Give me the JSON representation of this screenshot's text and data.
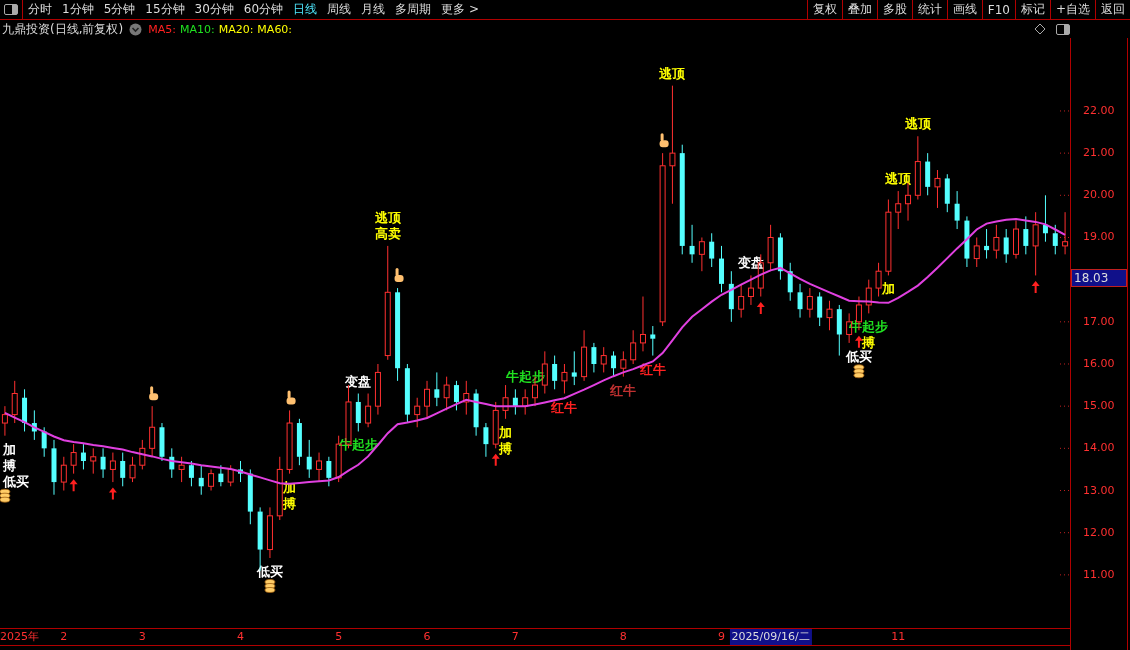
{
  "toolbar": {
    "periods": [
      {
        "label": "分时",
        "selected": false
      },
      {
        "label": "1分钟",
        "selected": false
      },
      {
        "label": "5分钟",
        "selected": false
      },
      {
        "label": "15分钟",
        "selected": false
      },
      {
        "label": "30分钟",
        "selected": false
      },
      {
        "label": "60分钟",
        "selected": false
      },
      {
        "label": "日线",
        "selected": true
      },
      {
        "label": "周线",
        "selected": false
      },
      {
        "label": "月线",
        "selected": false
      },
      {
        "label": "多周期",
        "selected": false
      },
      {
        "label": "更多 >",
        "selected": false
      }
    ],
    "buttons": [
      "复权",
      "叠加",
      "多股",
      "统计",
      "画线",
      "F10",
      "标记",
      "+自选",
      "返回"
    ]
  },
  "info": {
    "title": "九鼎投资(日线,前复权)",
    "indicators": [
      {
        "label": "MA5:",
        "color": "#ff2020"
      },
      {
        "label": "MA10:",
        "color": "#20e020"
      },
      {
        "label": "MA20:",
        "color": "#ffff00"
      },
      {
        "label": "MA60:",
        "color": "#ffff00"
      }
    ]
  },
  "chart_data": {
    "type": "candlestick",
    "categories": [
      null,
      "2025年",
      null,
      null,
      null,
      null,
      "2",
      null,
      null,
      null,
      null,
      null,
      null,
      null,
      "3",
      null,
      null,
      null,
      null,
      null,
      null,
      null,
      null,
      null,
      "4",
      null,
      null,
      null,
      null,
      null,
      null,
      null,
      null,
      null,
      "5",
      null,
      null,
      null,
      null,
      null,
      null,
      null,
      null,
      "6",
      null,
      null,
      null,
      null,
      null,
      null,
      null,
      null,
      "7",
      null,
      null,
      null,
      null,
      null,
      null,
      null,
      null,
      null,
      null,
      "8",
      null,
      null,
      null,
      null,
      null,
      null,
      null,
      null,
      null,
      "9",
      null,
      null,
      null,
      null,
      null,
      null,
      null,
      null,
      null,
      null,
      null,
      null,
      null,
      null,
      null,
      null,
      null,
      "11",
      null,
      null,
      null,
      null,
      null,
      null,
      null,
      null,
      null,
      null,
      null,
      null,
      null,
      null,
      null,
      null,
      null
    ],
    "ohlc": [
      [
        14.6,
        15.0,
        14.3,
        14.8
      ],
      [
        14.8,
        15.6,
        14.6,
        15.3
      ],
      [
        15.2,
        15.4,
        14.4,
        14.6
      ],
      [
        14.6,
        14.9,
        14.2,
        14.4
      ],
      [
        14.4,
        14.5,
        13.8,
        14.0
      ],
      [
        14.0,
        14.2,
        12.9,
        13.2
      ],
      [
        13.2,
        13.8,
        13.0,
        13.6
      ],
      [
        13.6,
        14.1,
        13.4,
        13.9
      ],
      [
        13.9,
        14.1,
        13.5,
        13.7
      ],
      [
        13.7,
        14.0,
        13.4,
        13.8
      ],
      [
        13.8,
        14.0,
        13.3,
        13.5
      ],
      [
        13.5,
        13.9,
        13.2,
        13.7
      ],
      [
        13.7,
        13.9,
        13.1,
        13.3
      ],
      [
        13.3,
        13.8,
        13.2,
        13.6
      ],
      [
        13.6,
        14.2,
        13.5,
        14.0
      ],
      [
        14.0,
        15.0,
        13.8,
        14.5
      ],
      [
        14.5,
        14.6,
        13.7,
        13.8
      ],
      [
        13.8,
        14.0,
        13.3,
        13.5
      ],
      [
        13.5,
        13.8,
        13.2,
        13.6
      ],
      [
        13.6,
        13.7,
        13.1,
        13.3
      ],
      [
        13.3,
        13.6,
        12.9,
        13.1
      ],
      [
        13.1,
        13.5,
        13.0,
        13.4
      ],
      [
        13.4,
        13.6,
        13.1,
        13.2
      ],
      [
        13.2,
        13.6,
        13.1,
        13.5
      ],
      [
        13.5,
        13.7,
        13.2,
        13.4
      ],
      [
        13.4,
        13.5,
        12.2,
        12.5
      ],
      [
        12.5,
        12.6,
        11.1,
        11.6
      ],
      [
        11.6,
        12.6,
        11.4,
        12.4
      ],
      [
        12.4,
        13.8,
        12.3,
        13.5
      ],
      [
        13.5,
        14.9,
        13.4,
        14.6
      ],
      [
        14.6,
        14.7,
        13.6,
        13.8
      ],
      [
        13.8,
        14.2,
        13.3,
        13.5
      ],
      [
        13.5,
        13.9,
        13.2,
        13.7
      ],
      [
        13.7,
        13.8,
        13.1,
        13.3
      ],
      [
        13.3,
        14.3,
        13.2,
        14.1
      ],
      [
        14.1,
        15.5,
        14.0,
        15.1
      ],
      [
        15.1,
        15.3,
        14.4,
        14.6
      ],
      [
        14.6,
        15.3,
        14.5,
        15.0
      ],
      [
        15.0,
        16.0,
        14.8,
        15.8
      ],
      [
        16.2,
        18.8,
        16.1,
        17.7
      ],
      [
        17.7,
        17.8,
        15.6,
        15.9
      ],
      [
        15.9,
        16.0,
        14.6,
        14.8
      ],
      [
        14.8,
        15.2,
        14.5,
        15.0
      ],
      [
        15.0,
        15.6,
        14.7,
        15.4
      ],
      [
        15.4,
        15.8,
        15.0,
        15.2
      ],
      [
        15.2,
        15.7,
        14.9,
        15.5
      ],
      [
        15.5,
        15.6,
        14.9,
        15.1
      ],
      [
        15.1,
        15.6,
        14.8,
        15.3
      ],
      [
        15.3,
        15.4,
        14.3,
        14.5
      ],
      [
        14.5,
        14.6,
        13.8,
        14.1
      ],
      [
        14.1,
        15.1,
        14.0,
        14.9
      ],
      [
        14.9,
        15.5,
        14.7,
        15.2
      ],
      [
        15.2,
        15.4,
        14.8,
        15.0
      ],
      [
        15.0,
        15.4,
        14.8,
        15.2
      ],
      [
        15.2,
        15.7,
        15.0,
        15.5
      ],
      [
        15.5,
        16.3,
        15.3,
        16.0
      ],
      [
        16.0,
        16.2,
        15.4,
        15.6
      ],
      [
        15.6,
        16.0,
        15.3,
        15.8
      ],
      [
        15.8,
        16.3,
        15.5,
        15.7
      ],
      [
        15.7,
        16.8,
        15.6,
        16.4
      ],
      [
        16.4,
        16.5,
        15.8,
        16.0
      ],
      [
        16.0,
        16.4,
        15.8,
        16.2
      ],
      [
        16.2,
        16.3,
        15.7,
        15.9
      ],
      [
        15.9,
        16.3,
        15.7,
        16.1
      ],
      [
        16.1,
        16.8,
        16.0,
        16.5
      ],
      [
        16.5,
        17.6,
        16.3,
        16.7
      ],
      [
        16.7,
        16.9,
        16.2,
        16.6
      ],
      [
        17.0,
        21.0,
        16.9,
        20.7
      ],
      [
        20.7,
        22.6,
        19.8,
        21.0
      ],
      [
        21.0,
        21.2,
        18.6,
        18.8
      ],
      [
        18.8,
        19.3,
        18.4,
        18.6
      ],
      [
        18.6,
        19.0,
        18.2,
        18.9
      ],
      [
        18.9,
        19.1,
        18.3,
        18.5
      ],
      [
        18.5,
        18.8,
        17.7,
        17.9
      ],
      [
        17.9,
        18.2,
        17.0,
        17.3
      ],
      [
        17.3,
        17.9,
        17.1,
        17.6
      ],
      [
        17.6,
        18.1,
        17.4,
        17.8
      ],
      [
        17.8,
        18.6,
        17.6,
        18.4
      ],
      [
        18.4,
        19.3,
        18.2,
        19.0
      ],
      [
        19.0,
        19.1,
        18.0,
        18.2
      ],
      [
        18.2,
        18.4,
        17.5,
        17.7
      ],
      [
        17.7,
        17.9,
        17.1,
        17.3
      ],
      [
        17.3,
        17.8,
        17.1,
        17.6
      ],
      [
        17.6,
        17.7,
        16.9,
        17.1
      ],
      [
        17.1,
        17.5,
        16.8,
        17.3
      ],
      [
        17.3,
        17.4,
        16.2,
        16.7
      ],
      [
        16.7,
        17.2,
        16.5,
        17.0
      ],
      [
        17.0,
        17.6,
        16.8,
        17.4
      ],
      [
        17.4,
        18.0,
        17.2,
        17.8
      ],
      [
        17.8,
        18.4,
        17.6,
        18.2
      ],
      [
        18.2,
        19.9,
        18.1,
        19.6
      ],
      [
        19.6,
        20.1,
        19.2,
        19.8
      ],
      [
        19.8,
        20.3,
        19.4,
        20.0
      ],
      [
        20.0,
        21.4,
        19.9,
        20.8
      ],
      [
        20.8,
        21.0,
        20.0,
        20.2
      ],
      [
        20.2,
        20.6,
        19.7,
        20.4
      ],
      [
        20.4,
        20.5,
        19.6,
        19.8
      ],
      [
        19.8,
        20.1,
        19.2,
        19.4
      ],
      [
        19.4,
        19.5,
        18.3,
        18.5
      ],
      [
        18.5,
        19.0,
        18.3,
        18.8
      ],
      [
        18.8,
        19.2,
        18.5,
        18.7
      ],
      [
        18.7,
        19.3,
        18.5,
        19.0
      ],
      [
        19.0,
        19.2,
        18.4,
        18.6
      ],
      [
        18.6,
        19.4,
        18.5,
        19.2
      ],
      [
        19.2,
        19.5,
        18.6,
        18.8
      ],
      [
        18.8,
        19.6,
        18.1,
        19.3
      ],
      [
        19.3,
        20.0,
        18.9,
        19.1
      ],
      [
        19.1,
        19.3,
        18.6,
        18.8
      ],
      [
        18.8,
        19.6,
        18.6,
        18.9
      ]
    ],
    "series": [
      {
        "type": "line",
        "color": "#e040e0",
        "values": [
          14.84,
          14.73,
          14.62,
          14.5,
          14.39,
          14.28,
          14.19,
          14.15,
          14.12,
          14.08,
          14.05,
          14.01,
          13.97,
          13.91,
          13.86,
          13.81,
          13.75,
          13.7,
          13.67,
          13.64,
          13.6,
          13.57,
          13.54,
          13.51,
          13.45,
          13.38,
          13.31,
          13.24,
          13.17,
          13.16,
          13.18,
          13.2,
          13.22,
          13.24,
          13.32,
          13.47,
          13.61,
          13.81,
          14.08,
          14.36,
          14.57,
          14.61,
          14.66,
          14.72,
          14.83,
          14.94,
          15.05,
          15.15,
          15.1,
          15.05,
          15.0,
          15.0,
          15.0,
          15.0,
          15.04,
          15.09,
          15.14,
          15.19,
          15.29,
          15.39,
          15.5,
          15.61,
          15.71,
          15.8,
          15.88,
          15.97,
          16.06,
          16.26,
          16.56,
          16.87,
          17.12,
          17.3,
          17.48,
          17.64,
          17.76,
          17.88,
          18.0,
          18.12,
          18.22,
          18.28,
          18.15,
          18.02,
          17.9,
          17.8,
          17.7,
          17.6,
          17.5,
          17.49,
          17.48,
          17.46,
          17.45,
          17.57,
          17.71,
          17.86,
          18.06,
          18.28,
          18.51,
          18.74,
          18.96,
          19.19,
          19.33,
          19.38,
          19.42,
          19.44,
          19.4,
          19.37,
          19.31,
          19.19,
          19.06
        ]
      }
    ],
    "ylim": [
      9.74,
      23.73
    ],
    "yticks": [
      {
        "value": 11,
        "label": "11.00"
      },
      {
        "value": 12,
        "label": "12.00"
      },
      {
        "value": 13,
        "label": "13.00"
      },
      {
        "value": 14,
        "label": "14.00"
      },
      {
        "value": 15,
        "label": "15.00"
      },
      {
        "value": 16,
        "label": "16.00"
      },
      {
        "value": 17,
        "label": "17.00"
      },
      {
        "value": 19,
        "label": "19.00"
      },
      {
        "value": 20,
        "label": "20.00"
      },
      {
        "value": 21,
        "label": "21.00"
      },
      {
        "value": 22,
        "label": "22.00"
      }
    ]
  },
  "signals": [
    {
      "kind": "label",
      "text": "加",
      "color": "#ffffff"
    },
    {
      "kind": "label",
      "text": "搏",
      "color": "#ffffff"
    },
    {
      "kind": "label",
      "text": "低买",
      "color": "#ffffff"
    },
    {
      "kind": "coin"
    },
    {
      "kind": "arrow"
    },
    {
      "kind": "arrow"
    },
    {
      "kind": "hand"
    },
    {
      "kind": "label",
      "text": "低买",
      "color": "#ffffff"
    },
    {
      "kind": "coin"
    },
    {
      "kind": "hand"
    },
    {
      "kind": "label",
      "text": "加",
      "color": "#ffff00"
    },
    {
      "kind": "label",
      "text": "搏",
      "color": "#ffff00"
    },
    {
      "kind": "label",
      "text": "变盘",
      "color": "#ffffff"
    },
    {
      "kind": "label",
      "text": "牛起步",
      "color": "#20e020"
    },
    {
      "kind": "label",
      "text": "高卖",
      "color": "#ffff00"
    },
    {
      "kind": "label",
      "text": "逃顶",
      "color": "#ffff00"
    },
    {
      "kind": "hand"
    },
    {
      "kind": "arrow"
    },
    {
      "kind": "label",
      "text": "加",
      "color": "#ffff00"
    },
    {
      "kind": "label",
      "text": "搏",
      "color": "#ffff00"
    },
    {
      "kind": "label",
      "text": "牛起步",
      "color": "#20e020"
    },
    {
      "kind": "label",
      "text": "红牛",
      "color": "#ff2020"
    },
    {
      "kind": "label",
      "text": "红牛",
      "color": "#c03030"
    },
    {
      "kind": "label",
      "text": "红牛",
      "color": "#ff2020"
    },
    {
      "kind": "hand"
    },
    {
      "kind": "label",
      "text": "逃顶",
      "color": "#ffff00"
    },
    {
      "kind": "label",
      "text": "变盘",
      "color": "#ffffff"
    },
    {
      "kind": "arrow"
    },
    {
      "kind": "label",
      "text": "牛起步",
      "color": "#20e020"
    },
    {
      "kind": "label",
      "text": "搏",
      "color": "#ffff00"
    },
    {
      "kind": "arrow"
    },
    {
      "kind": "label",
      "text": "低买",
      "color": "#ffffff"
    },
    {
      "kind": "coin"
    },
    {
      "kind": "label",
      "text": "逃顶",
      "color": "#ffff00"
    },
    {
      "kind": "label",
      "text": "逃顶",
      "color": "#ffff00"
    },
    {
      "kind": "label",
      "text": "加",
      "color": "#ffff00"
    },
    {
      "kind": "arrow"
    }
  ],
  "last_price": {
    "label": "18.03"
  },
  "cursor_date": {
    "label": "2025/09/16/二"
  }
}
